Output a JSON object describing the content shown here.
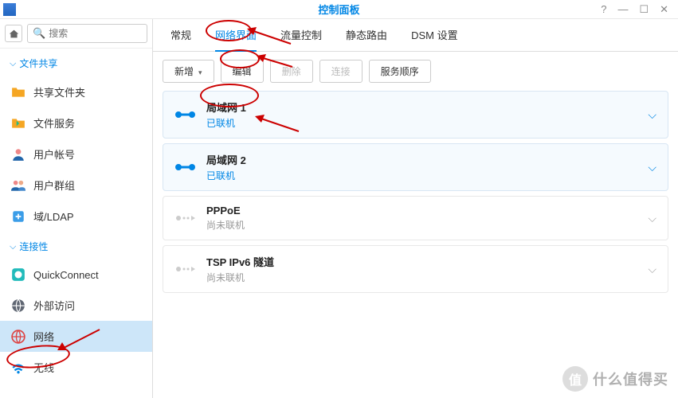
{
  "titlebar": {
    "title": "控制面板"
  },
  "search": {
    "placeholder": "搜索"
  },
  "sections": {
    "fileShare": "文件共享",
    "connectivity": "连接性"
  },
  "sidebar": {
    "sharedFolder": "共享文件夹",
    "fileServices": "文件服务",
    "userAccount": "用户帐号",
    "userGroup": "用户群组",
    "domainLdap": "域/LDAP",
    "quickConnect": "QuickConnect",
    "externalAccess": "外部访问",
    "network": "网络",
    "wireless": "无线"
  },
  "tabs": {
    "general": "常规",
    "networkInterface": "网络界面",
    "trafficControl": "流量控制",
    "staticRoute": "静态路由",
    "dsmSettings": "DSM 设置"
  },
  "toolbar": {
    "add": "新增",
    "edit": "编辑",
    "delete": "删除",
    "connect": "连接",
    "serviceOrder": "服务顺序"
  },
  "connections": [
    {
      "title": "局域网 1",
      "status": "已联机",
      "connected": true
    },
    {
      "title": "局域网 2",
      "status": "已联机",
      "connected": true
    },
    {
      "title": "PPPoE",
      "status": "尚未联机",
      "connected": false
    },
    {
      "title": "TSP IPv6 隧道",
      "status": "尚未联机",
      "connected": false
    }
  ],
  "watermark": {
    "char": "值",
    "text": "什么值得买"
  }
}
